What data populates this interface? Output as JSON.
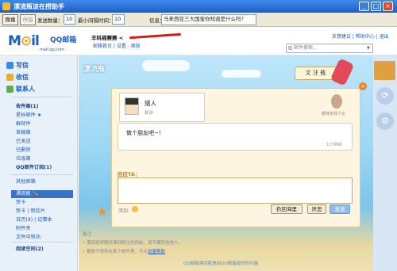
{
  "window": {
    "title": "漂流瓶该在捞助手",
    "min": "_",
    "max": "□",
    "close": "×"
  },
  "toolstrip": {
    "btn_start": "撒播",
    "btn_stop": "停指",
    "send_count_label": "发送数量：",
    "send_count": "10",
    "min_interval_label": "最小间隔时间：",
    "min_interval": "10",
    "msg_label": "信息：",
    "msg_value": "马来西亚三大国宝你知道是什么吗?"
  },
  "header": {
    "logo_m": "M",
    "logo_o": "⊙",
    "logo_il": "il",
    "logo_qq": "QQ邮箱",
    "logo_domain": "mail.qq.com",
    "user_prefix": "丰科摇赛赛 <",
    "sub_links": "邮箱首页 | 设置 - 换肤",
    "top_links": "反馈建议 | 帮助中心 | 退出",
    "search_placeholder": "邮件搜索..."
  },
  "sidebar": {
    "compose": "写信",
    "inbox_btn": "收信",
    "contacts": "联系人",
    "items": [
      {
        "label": "收件箱(1)",
        "style": "b"
      },
      {
        "label": "星标邮件 ★",
        "style": ""
      },
      {
        "label": "群邮件",
        "style": ""
      },
      {
        "label": "草稿箱",
        "style": ""
      },
      {
        "label": "已发送",
        "style": ""
      },
      {
        "label": "已删除",
        "style": ""
      },
      {
        "label": "垃圾箱",
        "style": ""
      },
      {
        "label": "QQ邮件订阅(1)",
        "style": "b"
      },
      {
        "label": "其他邮箱",
        "style": ""
      },
      {
        "label": "漂流瓶 🍾",
        "style": "sel"
      },
      {
        "label": "贺卡",
        "style": ""
      },
      {
        "label": "贺卡 | 明信片",
        "style": ""
      },
      {
        "label": "日历(9) | 记事本",
        "style": ""
      },
      {
        "label": "附件夹",
        "style": ""
      },
      {
        "label": "文件中转站",
        "style": ""
      },
      {
        "label": "阅读空间(2)",
        "style": "b"
      }
    ]
  },
  "scene": {
    "title": "漂流瓶",
    "bottle_btn": "文 注 瓶",
    "sender_name": "猎人",
    "sender_location": "长沙",
    "peer_label": "期待花样少女",
    "message": "做个朋友吧~!",
    "message_time": "1分钟前",
    "reply_header": "回应TA：",
    "add_label": "添加:",
    "btn_throw_back": "扔回海里",
    "btn_report": "厌恶",
    "btn_send": "发送",
    "remarks_title": "备注",
    "remark_1": "• 漂流瓶将随机漂到陌生的网友，请不要轻信他人。",
    "remark_2_prefix": "• 要是不想你在某个邮件里，可去",
    "remark_2_link": "设置帮助",
    "footer": "QQ邮箱漂流瓶是由QQ邮箱提供的功能"
  },
  "rail": {
    "icon1": "⟳",
    "icon2": "⚙"
  },
  "colors": {
    "brand": "#1d5fbd",
    "selected": "#3a72c8",
    "send": "#8fbde8"
  }
}
